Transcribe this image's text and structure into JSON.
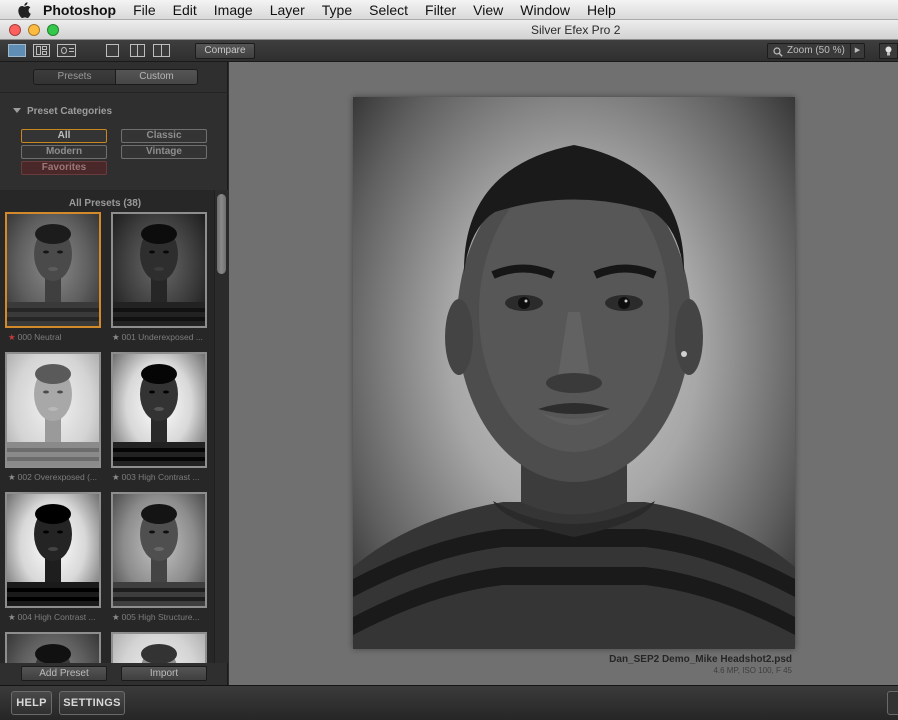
{
  "menubar": {
    "items": [
      "Photoshop",
      "File",
      "Edit",
      "Image",
      "Layer",
      "Type",
      "Select",
      "Filter",
      "View",
      "Window",
      "Help"
    ]
  },
  "window": {
    "title": "Silver Efex Pro 2",
    "lights": [
      "#fc615d",
      "#fdbc40",
      "#34c84a"
    ]
  },
  "toolbar": {
    "compare_label": "Compare",
    "zoom_label": "Zoom (50 %)"
  },
  "sidebar": {
    "tabs": [
      "Presets",
      "Custom"
    ],
    "categories_heading": "Preset Categories",
    "categories": [
      "All",
      "Classic",
      "Modern",
      "Vintage",
      "Favorites"
    ],
    "presets_heading": "All Presets (38)",
    "presets": [
      "000 Neutral",
      "001 Underexposed ...",
      "002 Overexposed (...",
      "003 High Contrast ...",
      "004 High Contrast ...",
      "005 High Structure..."
    ],
    "add_preset_label": "Add Preset",
    "import_label": "Import"
  },
  "preview": {
    "filename": "Dan_SEP2 Demo_Mike Headshot2.psd",
    "meta": "4.6 MP, ISO 100, F 45"
  },
  "footer": {
    "help_label": "HELP",
    "settings_label": "SETTINGS"
  }
}
